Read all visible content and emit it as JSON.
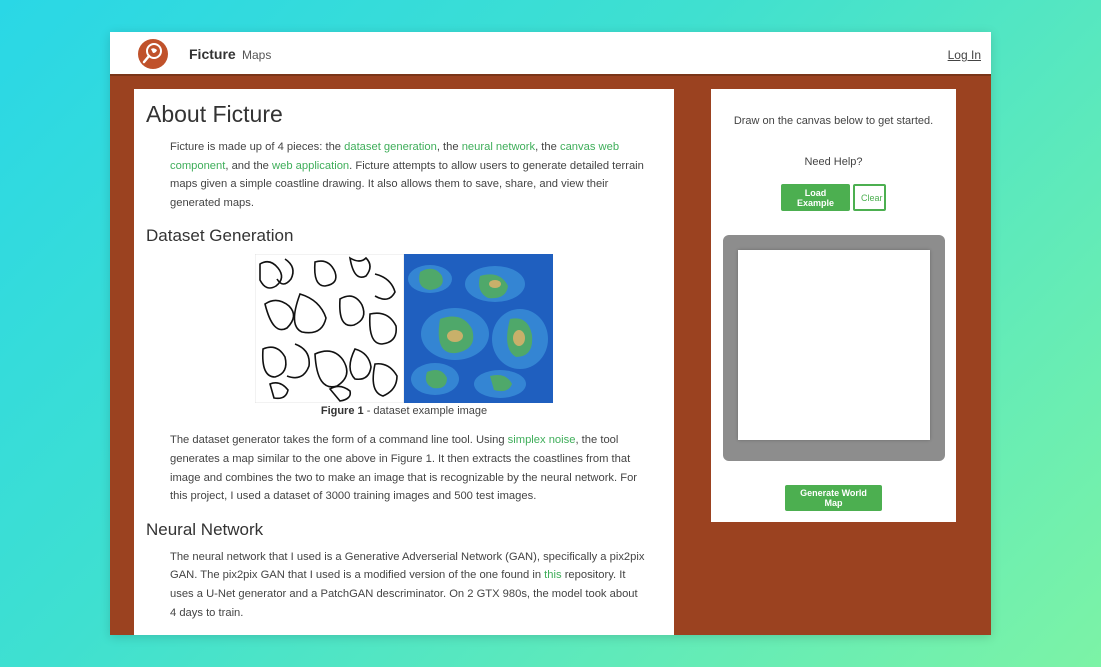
{
  "nav": {
    "brand": "Ficture",
    "maps_label": "Maps",
    "login_label": "Log In"
  },
  "about": {
    "title": "About Ficture",
    "intro_parts": {
      "t1": "Ficture is made up of 4 pieces: the ",
      "l1": "dataset generation",
      "t2": ", the ",
      "l2": "neural network",
      "t3": ", the ",
      "l3": "canvas web component",
      "t4": ", and the ",
      "l4": "web application",
      "t5": ". Ficture attempts to allow users to generate detailed terrain maps given a simple coastline drawing. It also allows them to save, share, and view their generated maps."
    }
  },
  "dataset": {
    "heading": "Dataset Generation",
    "figure_label": "Figure 1",
    "figure_caption": " - dataset example image",
    "para": {
      "t1": "The dataset generator takes the form of a command line tool. Using ",
      "l1": "simplex noise",
      "t2": ", the tool generates a map similar to the one above in Figure 1. It then extracts the coastlines from that image and combines the two to make an image that is recognizable by the neural network. For this project, I used a dataset of 3000 training images and 500 test images."
    }
  },
  "neural": {
    "heading": "Neural Network",
    "para": {
      "t1": "The neural network that I used is a Generative Adverserial Network (GAN), specifically a pix2pix GAN. The pix2pix GAN that I used is a modified version of the one found in ",
      "l1": "this",
      "t2": " repository. It uses a U-Net generator and a PatchGAN descriminator. On 2 GTX 980s, the model took about 4 days to train."
    }
  },
  "sidebar": {
    "instructions": "Draw on the canvas below to get started.",
    "help": "Need Help?",
    "load_example": "Load Example",
    "clear": "Clear",
    "generate": "Generate World Map"
  },
  "colors": {
    "accent": "#4caf50",
    "link": "#3fae5a",
    "page_background": "#9b4220",
    "logo": "#c0522b"
  },
  "icons": {
    "logo": "magnifier-globe-logo-icon"
  }
}
